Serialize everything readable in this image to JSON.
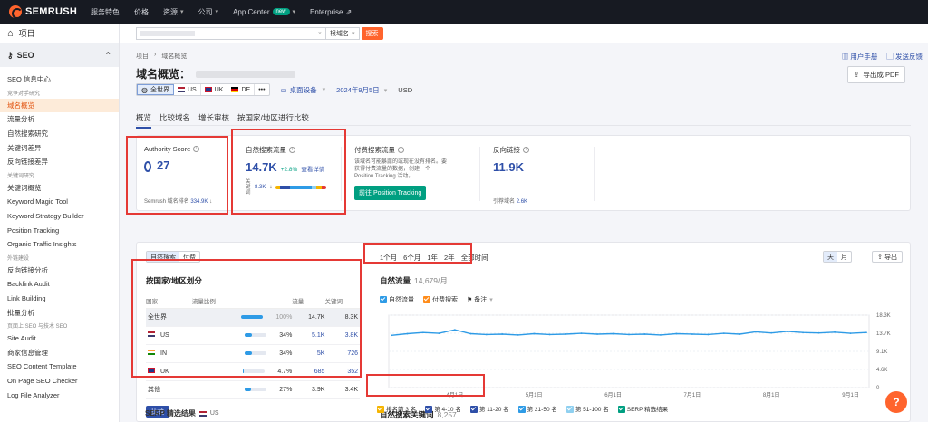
{
  "topbar": {
    "logo": "SEMRUSH",
    "nav": [
      {
        "label": "服务特色",
        "chevron": false
      },
      {
        "label": "价格",
        "chevron": false
      },
      {
        "label": "资源",
        "chevron": true
      },
      {
        "label": "公司",
        "chevron": true
      },
      {
        "label": "App Center",
        "badge": "new",
        "chevron": true
      },
      {
        "label": "Enterprise",
        "external": true
      }
    ]
  },
  "sidebar": {
    "projects": "项目",
    "seo": "SEO",
    "items": [
      {
        "type": "item",
        "label": "SEO 信息中心"
      },
      {
        "type": "head",
        "label": "竞争对手研究"
      },
      {
        "type": "item",
        "label": "域名概览",
        "active": true
      },
      {
        "type": "item",
        "label": "流量分析"
      },
      {
        "type": "item",
        "label": "自然搜索研究"
      },
      {
        "type": "item",
        "label": "关键词差异"
      },
      {
        "type": "item",
        "label": "反向链接差异"
      },
      {
        "type": "head",
        "label": "关键词研究"
      },
      {
        "type": "item",
        "label": "关键词概览"
      },
      {
        "type": "item",
        "label": "Keyword Magic Tool"
      },
      {
        "type": "item",
        "label": "Keyword Strategy Builder"
      },
      {
        "type": "item",
        "label": "Position Tracking"
      },
      {
        "type": "item",
        "label": "Organic Traffic Insights"
      },
      {
        "type": "head",
        "label": "外链建设"
      },
      {
        "type": "item",
        "label": "反向链接分析"
      },
      {
        "type": "item",
        "label": "Backlink Audit"
      },
      {
        "type": "item",
        "label": "Link Building"
      },
      {
        "type": "item",
        "label": "批量分析"
      },
      {
        "type": "head",
        "label": "页面上 SEO 与技术 SEO"
      },
      {
        "type": "item",
        "label": "Site Audit"
      },
      {
        "type": "item",
        "label": "商家信息管理"
      },
      {
        "type": "item",
        "label": "SEO Content Template"
      },
      {
        "type": "item",
        "label": "On Page SEO Checker"
      },
      {
        "type": "item",
        "label": "Log File Analyzer"
      }
    ]
  },
  "search": {
    "scope": "根域名",
    "button": "搜索"
  },
  "breadcrumb": {
    "root": "项目",
    "current": "域名概览"
  },
  "help": {
    "manual": "用户手册",
    "feedback": "发送反馈"
  },
  "page": {
    "title": "域名概览：",
    "pdf": "导出成 PDF"
  },
  "filters": {
    "databases": [
      {
        "label": "全世界",
        "flag": "globe",
        "selected": true
      },
      {
        "label": "US",
        "flag": "us"
      },
      {
        "label": "UK",
        "flag": "uk"
      },
      {
        "label": "DE",
        "flag": "de"
      },
      {
        "label": "•••",
        "flag": ""
      }
    ],
    "device": "桌面设备",
    "date": "2024年9月5日",
    "currency": "USD"
  },
  "tabs": [
    "概览",
    "比较域名",
    "增长审核",
    "按国家/地区进行比较"
  ],
  "kpis": {
    "authority": {
      "label": "Authority Score",
      "value": "27",
      "sub_label": "Semrush 域名排名",
      "sub_value": "334.9K"
    },
    "organic": {
      "label": "自然搜索流量",
      "value": "14.7K",
      "delta": "+2.8%",
      "link": "查看详情",
      "kw_label": "关键词",
      "kw_value": "8.3K"
    },
    "paid": {
      "label": "付费搜索流量",
      "note": "该域名可能暴露的或现在没有排名。要获得付费流量的数据，创建一个 Position Tracking 活动。",
      "button": "前往 Position Tracking"
    },
    "backlinks": {
      "label": "反向链接",
      "value": "11.9K",
      "sub_label": "引荐域名",
      "sub_value": "2.6K"
    }
  },
  "panel": {
    "toggle": [
      "自然搜索",
      "付费"
    ],
    "ranges": [
      "1个月",
      "6个月",
      "1年",
      "2年",
      "全部时间"
    ],
    "range_selected": 1,
    "granularity": [
      "天",
      "月"
    ],
    "export": "导出",
    "country_title": "按国家/地区划分",
    "country_headers": [
      "国家",
      "流量比例",
      "流量",
      "关键词"
    ],
    "countries": [
      {
        "name": "全世界",
        "flag": "",
        "share": "100%",
        "share_num": 100,
        "traffic": "14.7K",
        "keywords": "8.3K",
        "hl": true
      },
      {
        "name": "US",
        "flag": "us",
        "share": "34%",
        "share_num": 34,
        "traffic": "5.1K",
        "keywords": "3.8K"
      },
      {
        "name": "IN",
        "flag": "in",
        "share": "34%",
        "share_num": 34,
        "traffic": "5K",
        "keywords": "726"
      },
      {
        "name": "UK",
        "flag": "uk",
        "share": "4.7%",
        "share_num": 4.7,
        "traffic": "685",
        "keywords": "352"
      },
      {
        "name": "其他",
        "flag": "",
        "share": "27%",
        "share_num": 27,
        "traffic": "3.9K",
        "keywords": "3.4K"
      }
    ],
    "more": "比较",
    "traffic_title": "自然流量",
    "traffic_count": "14,679/月",
    "legend": [
      {
        "label": "自然流量",
        "color": "#2e9be6"
      },
      {
        "label": "付费搜索",
        "color": "#ff8c1a"
      },
      {
        "label": "备注",
        "icon": "flag-icon"
      }
    ],
    "kw_title": "自然搜索关键词",
    "kw_count": "8,257"
  },
  "chart_data": {
    "type": "line",
    "x": [
      "3月5日",
      "3月12日",
      "3月19日",
      "3月26日",
      "4月1日",
      "4月8日",
      "4月15日",
      "4月22日",
      "4月29日",
      "5月1日",
      "5月8日",
      "5月15日",
      "5月22日",
      "5月29日",
      "6月1日",
      "6月8日",
      "6月15日",
      "6月22日",
      "6月29日",
      "7月1日",
      "7月8日",
      "7月15日",
      "7月22日",
      "7月29日",
      "8月1日",
      "8月8日",
      "8月15日",
      "8月22日",
      "8月29日",
      "9月1日",
      "9月5日"
    ],
    "series": [
      {
        "values": [
          13.2,
          13.6,
          13.9,
          13.7,
          14.6,
          13.6,
          13.4,
          13.5,
          13.3,
          13.6,
          13.4,
          13.5,
          13.7,
          13.5,
          13.6,
          13.4,
          13.5,
          13.3,
          13.6,
          13.5,
          13.4,
          13.7,
          13.5,
          14.1,
          13.8,
          14.2,
          13.9,
          13.8,
          14.0,
          13.7,
          13.9
        ]
      }
    ],
    "xticks": [
      "4月1日",
      "5月1日",
      "6月1日",
      "7月1日",
      "8月1日",
      "9月1日"
    ],
    "yticks": [
      "18.3K",
      "13.7K",
      "9.1K",
      "4.6K",
      "0"
    ],
    "ylim": [
      0,
      18.3
    ],
    "grid": true
  },
  "bottom_legend": [
    {
      "label": "排名前 3 名",
      "color": "#f5b400"
    },
    {
      "label": "第 4-10 名",
      "color": "#2e4fa8"
    },
    {
      "label": "第 11-20 名",
      "color": "#2e4fa8"
    },
    {
      "label": "第 21-50 名",
      "color": "#2e9be6"
    },
    {
      "label": "第 51-100 名",
      "color": "#8fd0f0"
    },
    {
      "label": "SERP 精选结果",
      "color": "#009f81"
    }
  ],
  "serp": {
    "title": "SERP 精选结果",
    "flag": "us",
    "db": "US"
  },
  "fab": "?"
}
